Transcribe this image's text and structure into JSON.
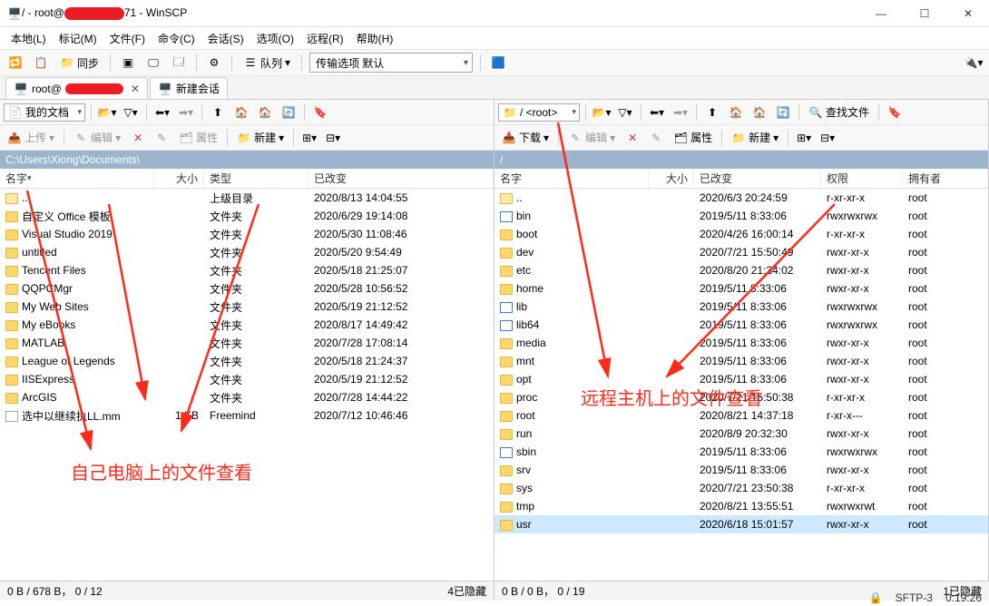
{
  "window": {
    "title_prefix": "/ - root@",
    "title_suffix": "71 - WinSCP"
  },
  "menu": [
    "本地(L)",
    "标记(M)",
    "文件(F)",
    "命令(C)",
    "会话(S)",
    "选项(O)",
    "远程(R)",
    "帮助(H)"
  ],
  "toolbar1": {
    "sync": "同步",
    "queue": "队列",
    "transfer_combo": "传输选项 默认"
  },
  "tabs": {
    "session": "root@",
    "new": "新建会话"
  },
  "left": {
    "location": "我的文档",
    "upload": "上传",
    "edit": "编辑",
    "props": "属性",
    "new": "新建",
    "path": "C:\\Users\\Xiong\\Documents\\",
    "cols": {
      "name": "名字",
      "size": "大小",
      "type": "类型",
      "changed": "已改变"
    },
    "rows": [
      {
        "icon": "up",
        "name": "..",
        "size": "",
        "type": "上级目录",
        "changed": "2020/8/13 14:04:55"
      },
      {
        "icon": "folder",
        "name": "自定义 Office 模板",
        "size": "",
        "type": "文件夹",
        "changed": "2020/6/29 19:14:08"
      },
      {
        "icon": "folder",
        "name": "Visual Studio 2019",
        "size": "",
        "type": "文件夹",
        "changed": "2020/5/30 11:08:46"
      },
      {
        "icon": "folder",
        "name": "untitled",
        "size": "",
        "type": "文件夹",
        "changed": "2020/5/20 9:54:49"
      },
      {
        "icon": "folder",
        "name": "Tencent Files",
        "size": "",
        "type": "文件夹",
        "changed": "2020/5/18 21:25:07"
      },
      {
        "icon": "folder",
        "name": "QQPCMgr",
        "size": "",
        "type": "文件夹",
        "changed": "2020/5/28 10:56:52"
      },
      {
        "icon": "folder",
        "name": "My Web Sites",
        "size": "",
        "type": "文件夹",
        "changed": "2020/5/19 21:12:52"
      },
      {
        "icon": "folder",
        "name": "My eBooks",
        "size": "",
        "type": "文件夹",
        "changed": "2020/8/17 14:49:42"
      },
      {
        "icon": "folder",
        "name": "MATLAB",
        "size": "",
        "type": "文件夹",
        "changed": "2020/7/28 17:08:14"
      },
      {
        "icon": "folder",
        "name": "League of Legends",
        "size": "",
        "type": "文件夹",
        "changed": "2020/5/18 21:24:37"
      },
      {
        "icon": "folder",
        "name": "IISExpress",
        "size": "",
        "type": "文件夹",
        "changed": "2020/5/19 21:12:52"
      },
      {
        "icon": "folder",
        "name": "ArcGIS",
        "size": "",
        "type": "文件夹",
        "changed": "2020/7/28 14:44:22"
      },
      {
        "icon": "file",
        "name": "选中以继续执LL.mm",
        "size": "1 KB",
        "type": "Freemind",
        "changed": "2020/7/12 10:46:46"
      }
    ],
    "status_l": "0 B / 678 B， 0 / 12",
    "status_r": "4已隐藏"
  },
  "right": {
    "location": "/ <root>",
    "download": "下载",
    "edit": "编辑",
    "props": "属性",
    "new": "新建",
    "find": "查找文件",
    "path": "/",
    "cols": {
      "name": "名字",
      "size": "大小",
      "changed": "已改变",
      "perm": "权限",
      "owner": "拥有者"
    },
    "rows": [
      {
        "icon": "up",
        "name": "..",
        "size": "",
        "changed": "2020/6/3 20:24:59",
        "perm": "r-xr-xr-x",
        "owner": "root"
      },
      {
        "icon": "link",
        "name": "bin",
        "size": "",
        "changed": "2019/5/11 8:33:06",
        "perm": "rwxrwxrwx",
        "owner": "root"
      },
      {
        "icon": "folder",
        "name": "boot",
        "size": "",
        "changed": "2020/4/26 16:00:14",
        "perm": "r-xr-xr-x",
        "owner": "root"
      },
      {
        "icon": "folder",
        "name": "dev",
        "size": "",
        "changed": "2020/7/21 15:50:49",
        "perm": "rwxr-xr-x",
        "owner": "root"
      },
      {
        "icon": "folder",
        "name": "etc",
        "size": "",
        "changed": "2020/8/20 21:34:02",
        "perm": "rwxr-xr-x",
        "owner": "root"
      },
      {
        "icon": "folder",
        "name": "home",
        "size": "",
        "changed": "2019/5/11 8:33:06",
        "perm": "rwxr-xr-x",
        "owner": "root"
      },
      {
        "icon": "link",
        "name": "lib",
        "size": "",
        "changed": "2019/5/11 8:33:06",
        "perm": "rwxrwxrwx",
        "owner": "root"
      },
      {
        "icon": "link",
        "name": "lib64",
        "size": "",
        "changed": "2019/5/11 8:33:06",
        "perm": "rwxrwxrwx",
        "owner": "root"
      },
      {
        "icon": "folder",
        "name": "media",
        "size": "",
        "changed": "2019/5/11 8:33:06",
        "perm": "rwxr-xr-x",
        "owner": "root"
      },
      {
        "icon": "folder",
        "name": "mnt",
        "size": "",
        "changed": "2019/5/11 8:33:06",
        "perm": "rwxr-xr-x",
        "owner": "root"
      },
      {
        "icon": "folder",
        "name": "opt",
        "size": "",
        "changed": "2019/5/11 8:33:06",
        "perm": "rwxr-xr-x",
        "owner": "root"
      },
      {
        "icon": "folder",
        "name": "proc",
        "size": "",
        "changed": "2020/7/21 15:50:38",
        "perm": "r-xr-xr-x",
        "owner": "root"
      },
      {
        "icon": "folder",
        "name": "root",
        "size": "",
        "changed": "2020/8/21 14:37:18",
        "perm": "r-xr-x---",
        "owner": "root"
      },
      {
        "icon": "folder",
        "name": "run",
        "size": "",
        "changed": "2020/8/9 20:32:30",
        "perm": "rwxr-xr-x",
        "owner": "root"
      },
      {
        "icon": "link",
        "name": "sbin",
        "size": "",
        "changed": "2019/5/11 8:33:06",
        "perm": "rwxrwxrwx",
        "owner": "root"
      },
      {
        "icon": "folder",
        "name": "srv",
        "size": "",
        "changed": "2019/5/11 8:33:06",
        "perm": "rwxr-xr-x",
        "owner": "root"
      },
      {
        "icon": "folder",
        "name": "sys",
        "size": "",
        "changed": "2020/7/21 23:50:38",
        "perm": "r-xr-xr-x",
        "owner": "root"
      },
      {
        "icon": "folder",
        "name": "tmp",
        "size": "",
        "changed": "2020/8/21 13:55:51",
        "perm": "rwxrwxrwt",
        "owner": "root"
      },
      {
        "icon": "folder",
        "name": "usr",
        "size": "",
        "changed": "2020/6/18 15:01:57",
        "perm": "rwxr-xr-x",
        "owner": "root",
        "sel": true
      }
    ],
    "status_l": "0 B / 0 B， 0 / 19",
    "status_r": "1已隐藏"
  },
  "footer": {
    "proto": "SFTP-3",
    "time": "0:19:26"
  },
  "annotations": {
    "left": "自己电脑上的文件查看",
    "right": "远程主机上的文件查看"
  }
}
